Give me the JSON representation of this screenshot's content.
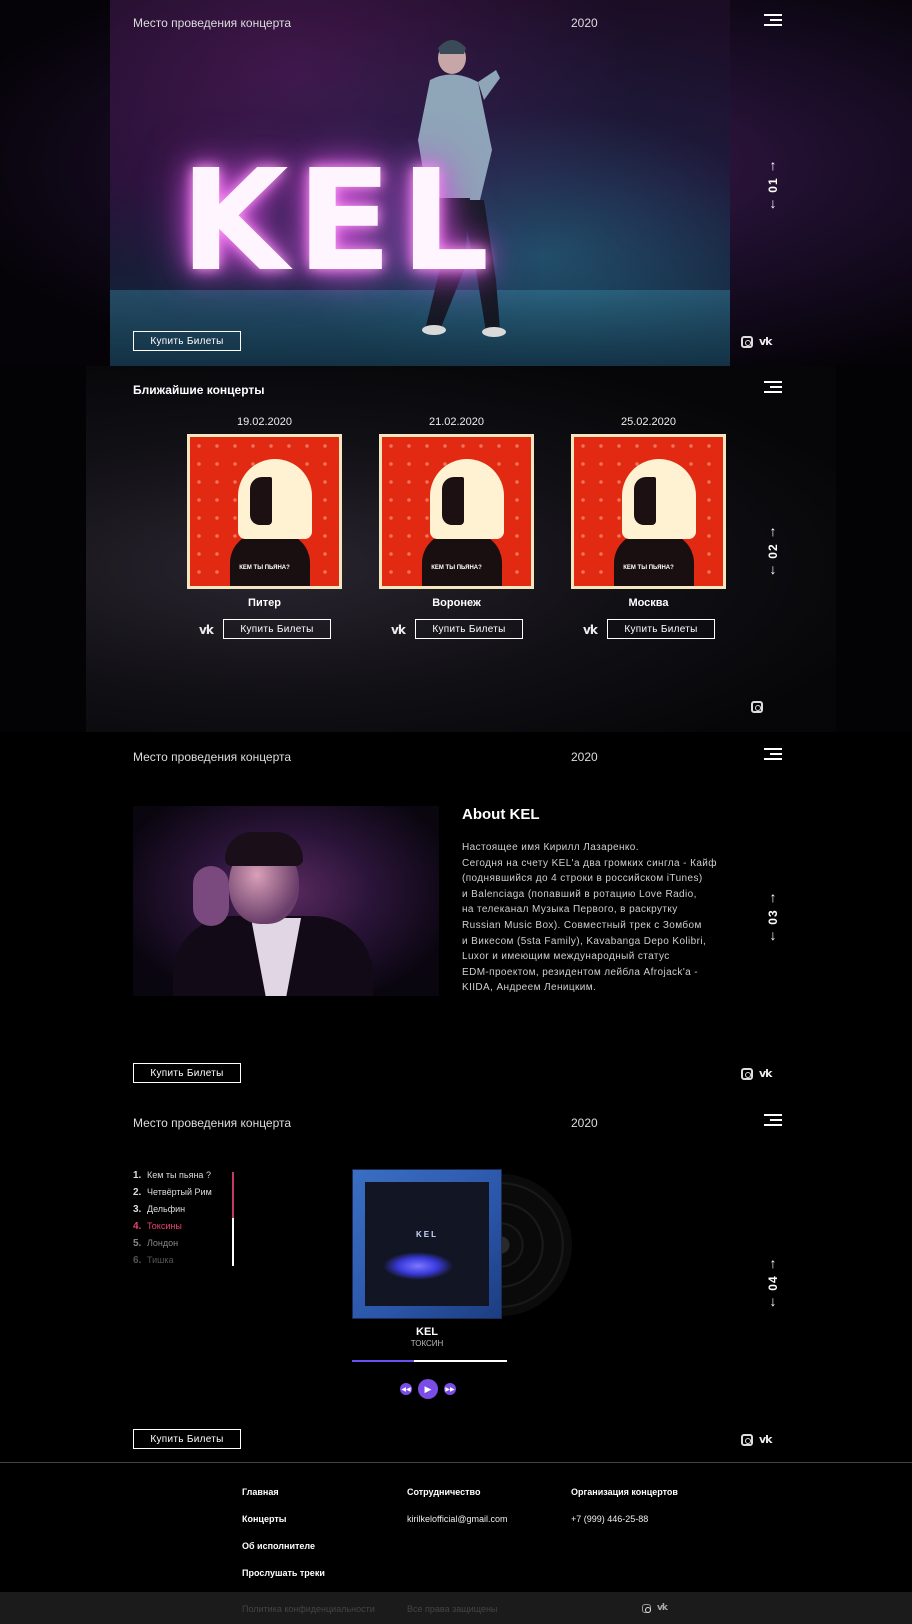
{
  "hero": {
    "venue": "Место проведения концерта",
    "year": "2020",
    "logo": "KEL",
    "buy_label": "Купить Билеты",
    "pager": "01"
  },
  "concerts": {
    "title": "Ближайшие концерты",
    "pager": "02",
    "buy_label": "Купить Билеты",
    "cover_text": "КЕМ ТЫ ПЬЯНА?",
    "items": [
      {
        "date": "19.02.2020",
        "city": "Питер"
      },
      {
        "date": "21.02.2020",
        "city": "Воронеж"
      },
      {
        "date": "25.02.2020",
        "city": "Москва"
      }
    ]
  },
  "about": {
    "venue": "Место проведения концерта",
    "year": "2020",
    "title": "About KEL",
    "text": "Настоящее имя Кирилл Лазаренко.\nСегодня на счету KEL'а два громких сингла - Кайф\n(поднявшийся до 4 строки в российском iTunes)\nи Balenciaga (попавший в ротацию Love Radio,\nна телеканал Музыка Первого, в раскрутку\nRussian Music Box). Совместный трек с Зомбом\nи Викесом (5sta Family), Kavabanga Depo Kolibri,\nLuxor и имеющим международный статус\nEDM-проектом, резидентом лейбла Afrojack'а -\nKIIDA, Андреем Леницким.",
    "buy_label": "Купить Билеты",
    "pager": "03"
  },
  "tracks": {
    "venue": "Место проведения концерта",
    "year": "2020",
    "pager": "04",
    "buy_label": "Купить Билеты",
    "list": [
      {
        "n": "1.",
        "title": "Кем ты пьяна ?"
      },
      {
        "n": "2.",
        "title": "Четвёртый Рим"
      },
      {
        "n": "3.",
        "title": "Дельфин"
      },
      {
        "n": "4.",
        "title": "Токсины"
      },
      {
        "n": "5.",
        "title": "Лондон"
      },
      {
        "n": "6.",
        "title": "Тишка"
      }
    ],
    "active_index": 4,
    "now_artist": "KEL",
    "now_title": "ТОКСИН",
    "album_label": "KEL",
    "progress": 0.4
  },
  "footer": {
    "col1": [
      "Главная",
      "Концерты",
      "Об исполнителе",
      "Прослушать треки"
    ],
    "col2_title": "Сотрудничество",
    "col2_email": "kirilkelofficial@gmail.com",
    "col3_title": "Организация концертов",
    "col3_phone": "+7 (999) 446-25-88",
    "privacy": "Политика конфиденциальности",
    "rights": "Все права защищены"
  },
  "icons": {
    "menu": "menu-icon",
    "instagram": "instagram-icon",
    "vk": "vk-icon",
    "arrow_up": "arrow-up-icon",
    "arrow_down": "arrow-down-icon",
    "play": "play-icon",
    "prev": "prev-icon",
    "next": "next-icon"
  },
  "colors": {
    "accent": "#7a4ee6",
    "active_track": "#e9436e",
    "neon": "#e35ce8",
    "cover_red": "#e22a12"
  }
}
